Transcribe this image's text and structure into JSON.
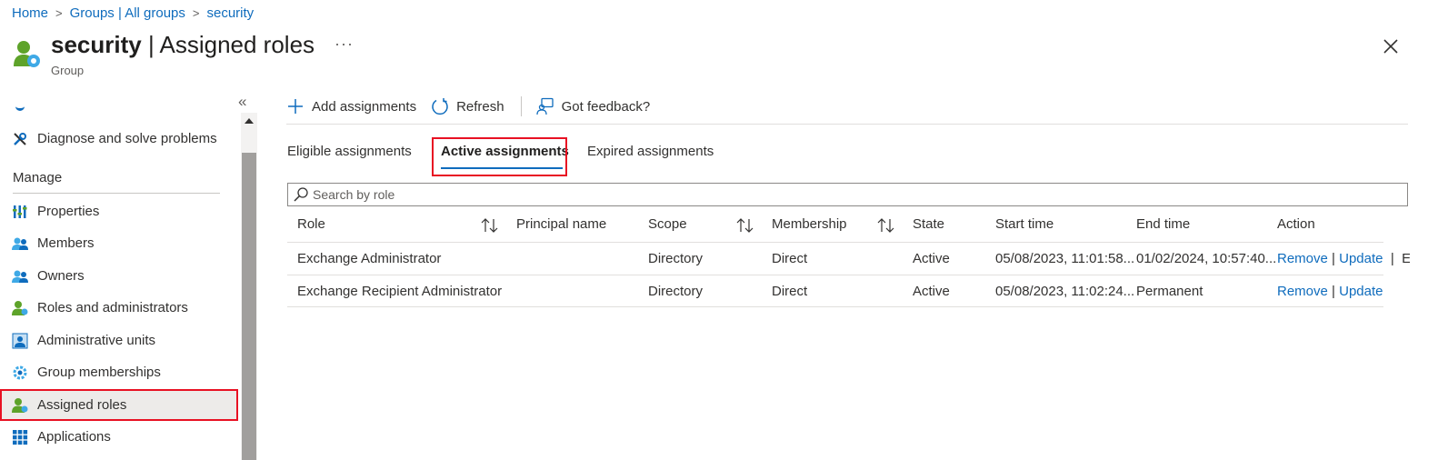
{
  "breadcrumb": {
    "home": "Home",
    "groups": "Groups | All groups",
    "current": "security",
    "sep": ">"
  },
  "header": {
    "title_bold": "security",
    "title_rest": " | Assigned roles",
    "subtitle": "Group",
    "more": "···"
  },
  "sidebar": {
    "collapse": "«",
    "manage_label": "Manage",
    "items": [
      {
        "label": "Diagnose and solve problems",
        "icon": "wrench-icon"
      },
      {
        "label": "Properties",
        "icon": "properties-icon"
      },
      {
        "label": "Members",
        "icon": "members-icon"
      },
      {
        "label": "Owners",
        "icon": "owners-icon"
      },
      {
        "label": "Roles and administrators",
        "icon": "roles-icon"
      },
      {
        "label": "Administrative units",
        "icon": "admin-units-icon"
      },
      {
        "label": "Group memberships",
        "icon": "gear-icon"
      },
      {
        "label": "Assigned roles",
        "icon": "assigned-roles-icon",
        "selected": true
      },
      {
        "label": "Applications",
        "icon": "grid-icon"
      }
    ]
  },
  "toolbar": {
    "add": "Add assignments",
    "refresh": "Refresh",
    "feedback": "Got feedback?"
  },
  "tabs": {
    "eligible": "Eligible assignments",
    "active": "Active assignments",
    "expired": "Expired assignments"
  },
  "search": {
    "placeholder": "Search by role"
  },
  "table": {
    "headers": {
      "role": "Role",
      "principal": "Principal name",
      "scope": "Scope",
      "membership": "Membership",
      "state": "State",
      "start": "Start time",
      "end": "End time",
      "action": "Action"
    },
    "rows": [
      {
        "role": "Exchange Administrator",
        "principal": "",
        "scope": "Directory",
        "membership": "Direct",
        "state": "Active",
        "start": "05/08/2023, 11:01:58...",
        "end": "01/02/2024, 10:57:40...",
        "remove": "Remove",
        "update": "Update",
        "extend": "Ex"
      },
      {
        "role": "Exchange Recipient Administrator",
        "principal": "",
        "scope": "Directory",
        "membership": "Direct",
        "state": "Active",
        "start": "05/08/2023, 11:02:24...",
        "end": "Permanent",
        "remove": "Remove",
        "update": "Update"
      }
    ]
  },
  "colors": {
    "link": "#0f6cbd",
    "highlight": "#e81123",
    "selected_bg": "#edebe9"
  }
}
